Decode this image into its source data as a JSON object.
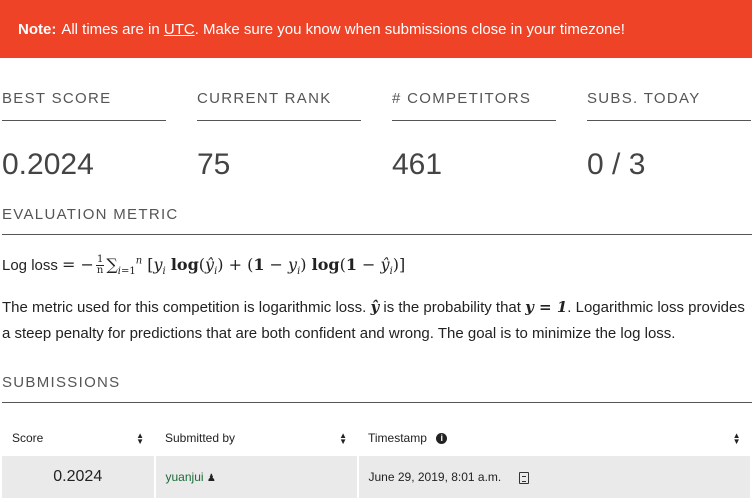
{
  "note": {
    "bold": "Note:",
    "pre": "All times are in",
    "link": "UTC",
    "post": ". Make sure you know when submissions close in your timezone!"
  },
  "stats": [
    {
      "label": "BEST SCORE",
      "value": "0.2024"
    },
    {
      "label": "CURRENT RANK",
      "value": "75"
    },
    {
      "label": "# COMPETITORS",
      "value": "461"
    },
    {
      "label": "SUBS. TODAY",
      "value": "0 / 3"
    }
  ],
  "evaluation": {
    "title": "EVALUATION METRIC",
    "formula_label": "Log loss",
    "description_1": "The metric used for this competition is logarithmic loss. ",
    "description_2": " is the probability that ",
    "description_3": ". Logarithmic loss provides a steep penalty for predictions that are both confident and wrong. The goal is to minimize the log loss."
  },
  "submissions": {
    "title": "SUBMISSIONS",
    "headers": [
      "Score",
      "Submitted by",
      "Timestamp"
    ],
    "rows": [
      {
        "score": "0.2024",
        "user": "yuanjui",
        "timestamp": "June 29, 2019, 8:01 a.m."
      }
    ]
  },
  "icons": {
    "sort": "sort-icon",
    "info": "info-icon",
    "user": "user-icon",
    "file": "file-icon"
  },
  "colors": {
    "note_bg": "#ef4328",
    "user_link": "#1c6b3a"
  }
}
